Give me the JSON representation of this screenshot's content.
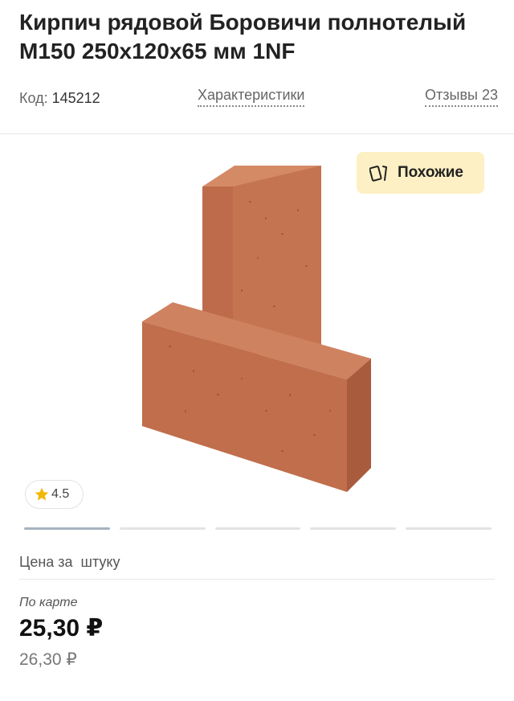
{
  "product": {
    "title_line1": "Кирпич рядовой Боровичи полнотелый",
    "title_line2": "М150 250х120х65 мм 1NF",
    "code_label": "Код:",
    "code_value": "145212",
    "characteristics_link": "Характеристики",
    "reviews_link": "Отзывы 23"
  },
  "gallery": {
    "similar_button": "Похожие",
    "similar_icon": "cards-icon",
    "rating_icon": "star-icon",
    "rating": "4.5",
    "slides_total": 5,
    "active_slide": 1
  },
  "price": {
    "unit_label": "Цена за",
    "unit_value": "штуку",
    "card_label": "По карте",
    "card_price": "25,30 ₽",
    "regular_price": "26,30 ₽"
  },
  "colors": {
    "similar_bg": "#fdf0c4",
    "star": "#f2b705",
    "brick": "#c87552"
  }
}
